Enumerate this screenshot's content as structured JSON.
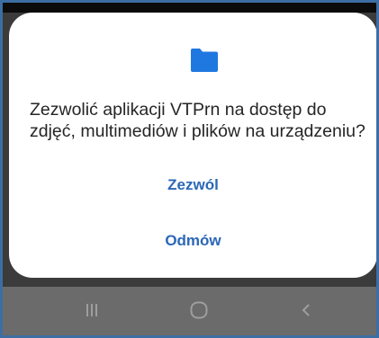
{
  "dialog": {
    "icon": "folder-icon",
    "message_line1": "Zezwolić aplikacji VTPrn na dostęp do",
    "message_line2": "zdjęć, multimediów i plików na urządzeniu?",
    "allow_label": "Zezwól",
    "deny_label": "Odmów"
  },
  "navbar": {
    "buttons": [
      {
        "name": "recents",
        "icon": "recents-icon"
      },
      {
        "name": "home",
        "icon": "home-icon"
      },
      {
        "name": "back",
        "icon": "back-icon"
      }
    ]
  },
  "colors": {
    "accent": "#2b67b6",
    "folder": "#1f78e0",
    "text": "#252525",
    "scrim": "#3b3b3b",
    "navbar": "#6b6b6b",
    "frame": "#3d6ea3"
  }
}
